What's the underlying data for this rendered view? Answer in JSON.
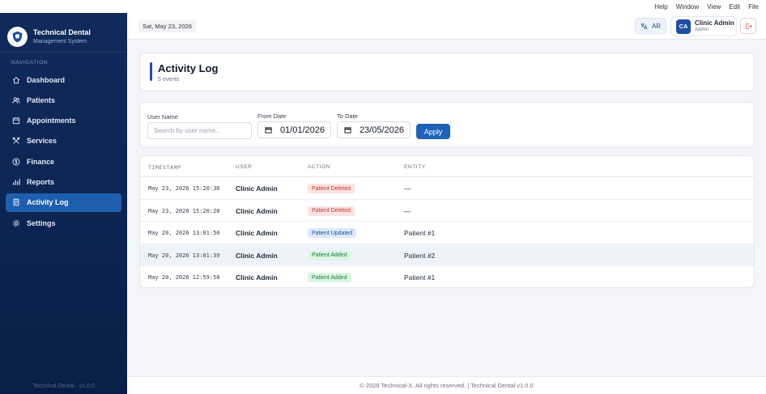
{
  "menubar": [
    "Help",
    "Window",
    "View",
    "Edit",
    "File"
  ],
  "brand": {
    "title": "Technical Dental",
    "subtitle": "Management System"
  },
  "nav": {
    "heading": "NAVIGATION",
    "items": [
      {
        "label": "Dashboard",
        "icon": "home-icon"
      },
      {
        "label": "Patients",
        "icon": "users-icon"
      },
      {
        "label": "Appointments",
        "icon": "calendar-icon"
      },
      {
        "label": "Services",
        "icon": "tools-icon"
      },
      {
        "label": "Finance",
        "icon": "dollar-icon"
      },
      {
        "label": "Reports",
        "icon": "chart-icon"
      },
      {
        "label": "Activity Log",
        "icon": "document-icon",
        "active": true
      },
      {
        "label": "Settings",
        "icon": "gear-icon"
      }
    ],
    "footer": "Technical Dental · v1.0.0"
  },
  "topbar": {
    "date": "Sat, May 23, 2026",
    "lang": "AR",
    "user": {
      "initials": "CA",
      "name": "Clinic Admin",
      "role": "Admin"
    }
  },
  "header": {
    "title": "Activity Log",
    "subtitle": "5 events"
  },
  "filters": {
    "user_label": "User Name",
    "user_placeholder": "Search by user name...",
    "from_label": "From Date",
    "from_value": "01/01/2026",
    "to_label": "To Date",
    "to_value": "23/05/2026",
    "apply": "Apply"
  },
  "table": {
    "columns": [
      "TIMESTAMP",
      "USER",
      "ACTION",
      "ENTITY"
    ],
    "rows": [
      {
        "timestamp": "May 23, 2026 15:20:30",
        "user": "Clinic Admin",
        "action": "Patient Deleted",
        "entity": "—",
        "kind": "deleted"
      },
      {
        "timestamp": "May 23, 2026 15:20:28",
        "user": "Clinic Admin",
        "action": "Patient Deleted",
        "entity": "—",
        "kind": "deleted"
      },
      {
        "timestamp": "May 20, 2026 13:01:50",
        "user": "Clinic Admin",
        "action": "Patient Updated",
        "entity": "Patient #1",
        "kind": "updated"
      },
      {
        "timestamp": "May 20, 2026 13:01:39",
        "user": "Clinic Admin",
        "action": "Patient Added",
        "entity": "Patient #2",
        "kind": "added",
        "highlight": true
      },
      {
        "timestamp": "May 20, 2026 12:59:50",
        "user": "Clinic Admin",
        "action": "Patient Added",
        "entity": "Patient #1",
        "kind": "added"
      }
    ]
  },
  "badge_colors": {
    "deleted": {
      "bg": "#fde2e2",
      "fg": "#c0392b"
    },
    "updated": {
      "bg": "#dde9fb",
      "fg": "#1e4fa3"
    },
    "added": {
      "bg": "#dcf5e3",
      "fg": "#1b7f3b"
    }
  },
  "footer": "© 2026 Technical-X. All rights reserved. | Technical Dental v1.0.0"
}
